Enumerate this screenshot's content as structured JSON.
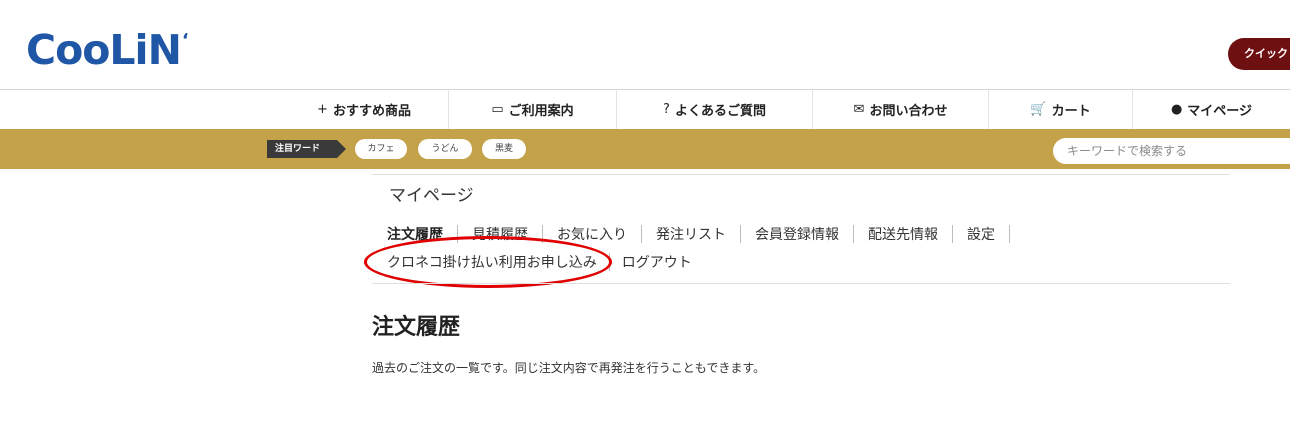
{
  "header": {
    "logo_text": "CooLiN",
    "logo_mark": "‘",
    "quick_button_label": "クイック"
  },
  "nav": {
    "items": [
      {
        "label": "おすすめ商品",
        "icon": "sparkle-icon",
        "glyph": "+"
      },
      {
        "label": "ご利用案内",
        "icon": "book-icon",
        "glyph": "▭"
      },
      {
        "label": "よくあるご質問",
        "icon": "question-circle-icon",
        "glyph": "?"
      },
      {
        "label": "お問い合わせ",
        "icon": "mail-icon",
        "glyph": "✉"
      },
      {
        "label": "カート",
        "icon": "cart-icon",
        "glyph": "🛒"
      },
      {
        "label": "マイページ",
        "icon": "user-icon",
        "glyph": "●"
      }
    ]
  },
  "trend_bar": {
    "label": "注目ワード",
    "tags": [
      "カフェ",
      "うどん",
      "黒麦"
    ],
    "search_placeholder": "キーワードで検索する"
  },
  "mypage": {
    "heading": "マイページ",
    "menu_row1": [
      "注文履歴",
      "見積履歴",
      "お気に入り",
      "発注リスト",
      "会員登録情報",
      "配送先情報",
      "設定"
    ],
    "menu_row2": [
      "クロネコ掛け払い利用お申し込み",
      "ログアウト"
    ]
  },
  "section": {
    "title": "注文履歴",
    "description": "過去のご注文の一覧です。同じ注文内容で再発注を行うこともできます。"
  },
  "colors": {
    "brand_blue": "#1f56a5",
    "gold_bar": "#c4a24a",
    "quick_button": "#6e0f12",
    "highlight_circle": "#e00000"
  }
}
